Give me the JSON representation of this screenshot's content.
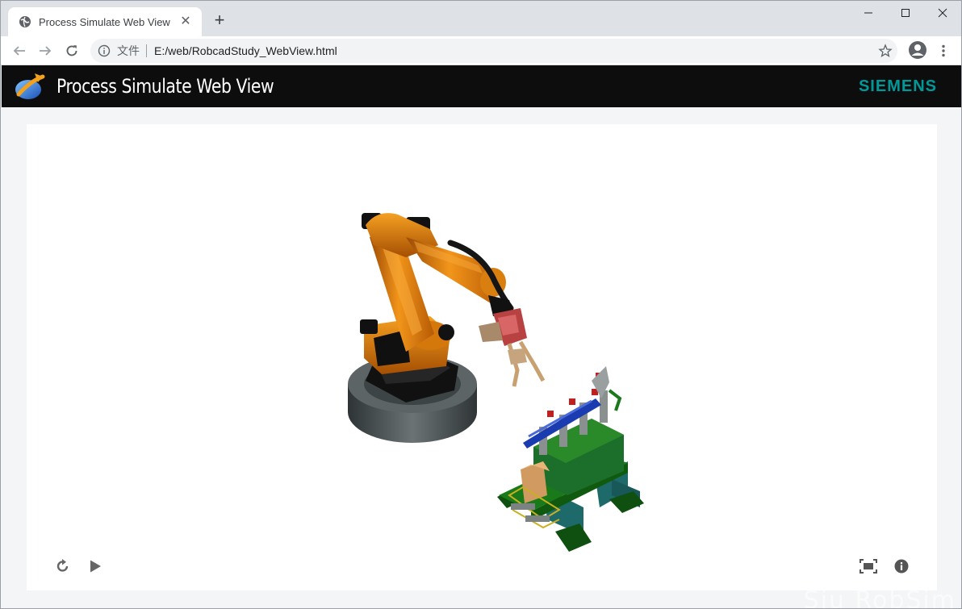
{
  "browser": {
    "tab_title": "Process Simulate Web View",
    "scheme_label": "文件",
    "url": "E:/web/RobcadStudy_WebView.html"
  },
  "app": {
    "title": "Process Simulate Web View",
    "brand": "SIEMENS"
  },
  "viewer": {
    "controls": [
      "rewind-icon",
      "play-icon",
      "fit-view-icon",
      "info-icon"
    ]
  },
  "watermark": "Siu  RobSim",
  "colors": {
    "header_bg": "#0d0d0d",
    "brand": "#009999",
    "robot_orange": "#e8870c",
    "fixture_green": "#1a7a1a",
    "fixture_teal": "#1e6a6a"
  }
}
